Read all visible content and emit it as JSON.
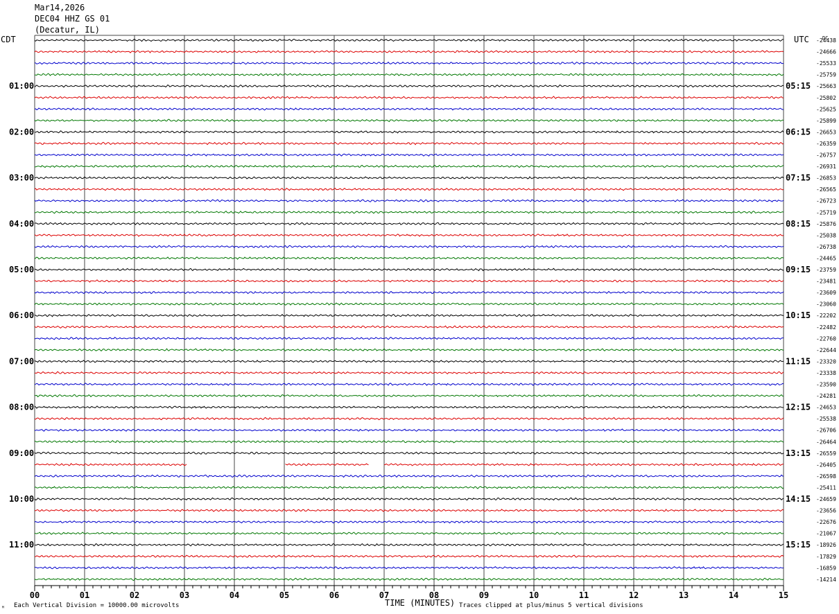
{
  "header": {
    "date": "Mar14,2026",
    "station": "DEC04 HHZ GS 01",
    "location": "(Decatur, IL)"
  },
  "left_zone_label": "CDT",
  "right_zone_label": "UTC",
  "dc_label": "DC",
  "xlabel": "TIME (MINUTES)",
  "footer": {
    "left": "Each Vertical Division = 10000.00 microvolts",
    "right": "Traces clipped at plus/minus 5 vertical divisions"
  },
  "chart_data": {
    "type": "line",
    "x_range": [
      0,
      15
    ],
    "x_ticks": [
      "00",
      "01",
      "02",
      "03",
      "04",
      "05",
      "06",
      "07",
      "08",
      "09",
      "10",
      "11",
      "12",
      "13",
      "14",
      "15"
    ],
    "trace_count": 48,
    "trace_colors": [
      "#000000",
      "#dd0000",
      "#0000cc",
      "#007700"
    ],
    "left_hour_labels": [
      "01:00",
      "02:00",
      "03:00",
      "04:00",
      "05:00",
      "06:00",
      "07:00",
      "08:00",
      "09:00",
      "10:00",
      "11:00"
    ],
    "right_hour_labels": [
      "05:15",
      "06:15",
      "07:15",
      "08:15",
      "09:15",
      "10:15",
      "11:15",
      "12:15",
      "13:15",
      "14:15",
      "15:15"
    ],
    "hour_label_rows": [
      4,
      8,
      12,
      16,
      20,
      24,
      28,
      32,
      36,
      40,
      44
    ],
    "dc_offsets": [
      "-24438",
      "-24666",
      "-25533",
      "-25759",
      "-25663",
      "-25802",
      "-25625",
      "-25899",
      "-26653",
      "-26359",
      "-26757",
      "-26931",
      "-26853",
      "-26565",
      "-26723",
      "-25719",
      "-25876",
      "-25038",
      "-26738",
      "-24465",
      "-23759",
      "-23481",
      "-23609",
      "-23060",
      "-22202",
      "-22482",
      "-22760",
      "-22644",
      "-23320",
      "-23338",
      "-23590",
      "-24281",
      "-24653",
      "-25538",
      "-26706",
      "-26464",
      "-26559",
      "-26405",
      "-26598",
      "-25411",
      "-24659",
      "-23656",
      "-22676",
      "-21067",
      "-18926",
      "-17829",
      "-16859",
      "-14214"
    ],
    "gaps": [
      {
        "trace": 37,
        "x_start": 3.05,
        "x_end": 5.0
      },
      {
        "trace": 37,
        "x_start": 6.7,
        "x_end": 6.98
      }
    ]
  }
}
